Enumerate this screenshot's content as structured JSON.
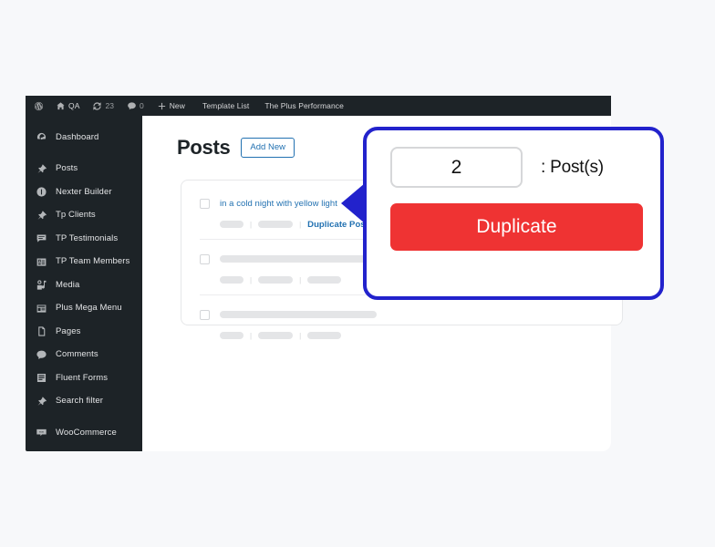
{
  "colors": {
    "accent_blue": "#2222cc",
    "link_blue": "#2271b1",
    "danger_red": "#ef3333",
    "sidebar_bg": "#1d2327",
    "page_bg": "#f7f8fa"
  },
  "admin_bar": {
    "items": [
      {
        "icon": "wordpress-logo-icon",
        "label": ""
      },
      {
        "icon": "home-icon",
        "label": "QA"
      },
      {
        "icon": "updates-icon",
        "label": "23"
      },
      {
        "icon": "comment-icon",
        "label": "0"
      },
      {
        "icon": "plus-icon",
        "label": "New"
      },
      {
        "icon": "",
        "label": "Template List"
      },
      {
        "icon": "",
        "label": "The Plus Performance"
      }
    ]
  },
  "sidebar": {
    "items": [
      {
        "label": "Dashboard",
        "icon": "dashboard-icon"
      },
      {
        "label": "Posts",
        "icon": "pin-icon"
      },
      {
        "label": "Nexter Builder",
        "icon": "circle-icon"
      },
      {
        "label": "Tp Clients",
        "icon": "pin-icon"
      },
      {
        "label": "TP Testimonials",
        "icon": "testimonial-icon"
      },
      {
        "label": "TP Team Members",
        "icon": "team-icon"
      },
      {
        "label": "Media",
        "icon": "media-icon"
      },
      {
        "label": "Plus Mega Menu",
        "icon": "megamenu-icon"
      },
      {
        "label": "Pages",
        "icon": "pages-icon"
      },
      {
        "label": "Comments",
        "icon": "comment-icon"
      },
      {
        "label": "Fluent Forms",
        "icon": "forms-icon"
      },
      {
        "label": "Search filter",
        "icon": "pin-icon"
      },
      {
        "label": "WooCommerce",
        "icon": "woocommerce-icon"
      }
    ]
  },
  "main": {
    "page_title": "Posts",
    "add_new_label": "Add New",
    "rows": [
      {
        "title": "in a cold night with yellow light",
        "duplicate_label": "Duplicate Post",
        "has_title_text": true
      },
      {
        "title": "",
        "duplicate_label": "",
        "has_title_text": false
      },
      {
        "title": "",
        "duplicate_label": "",
        "has_title_text": false
      }
    ]
  },
  "callout": {
    "quantity_value": "2",
    "quantity_label": ": Post(s)",
    "duplicate_button_label": "Duplicate"
  }
}
